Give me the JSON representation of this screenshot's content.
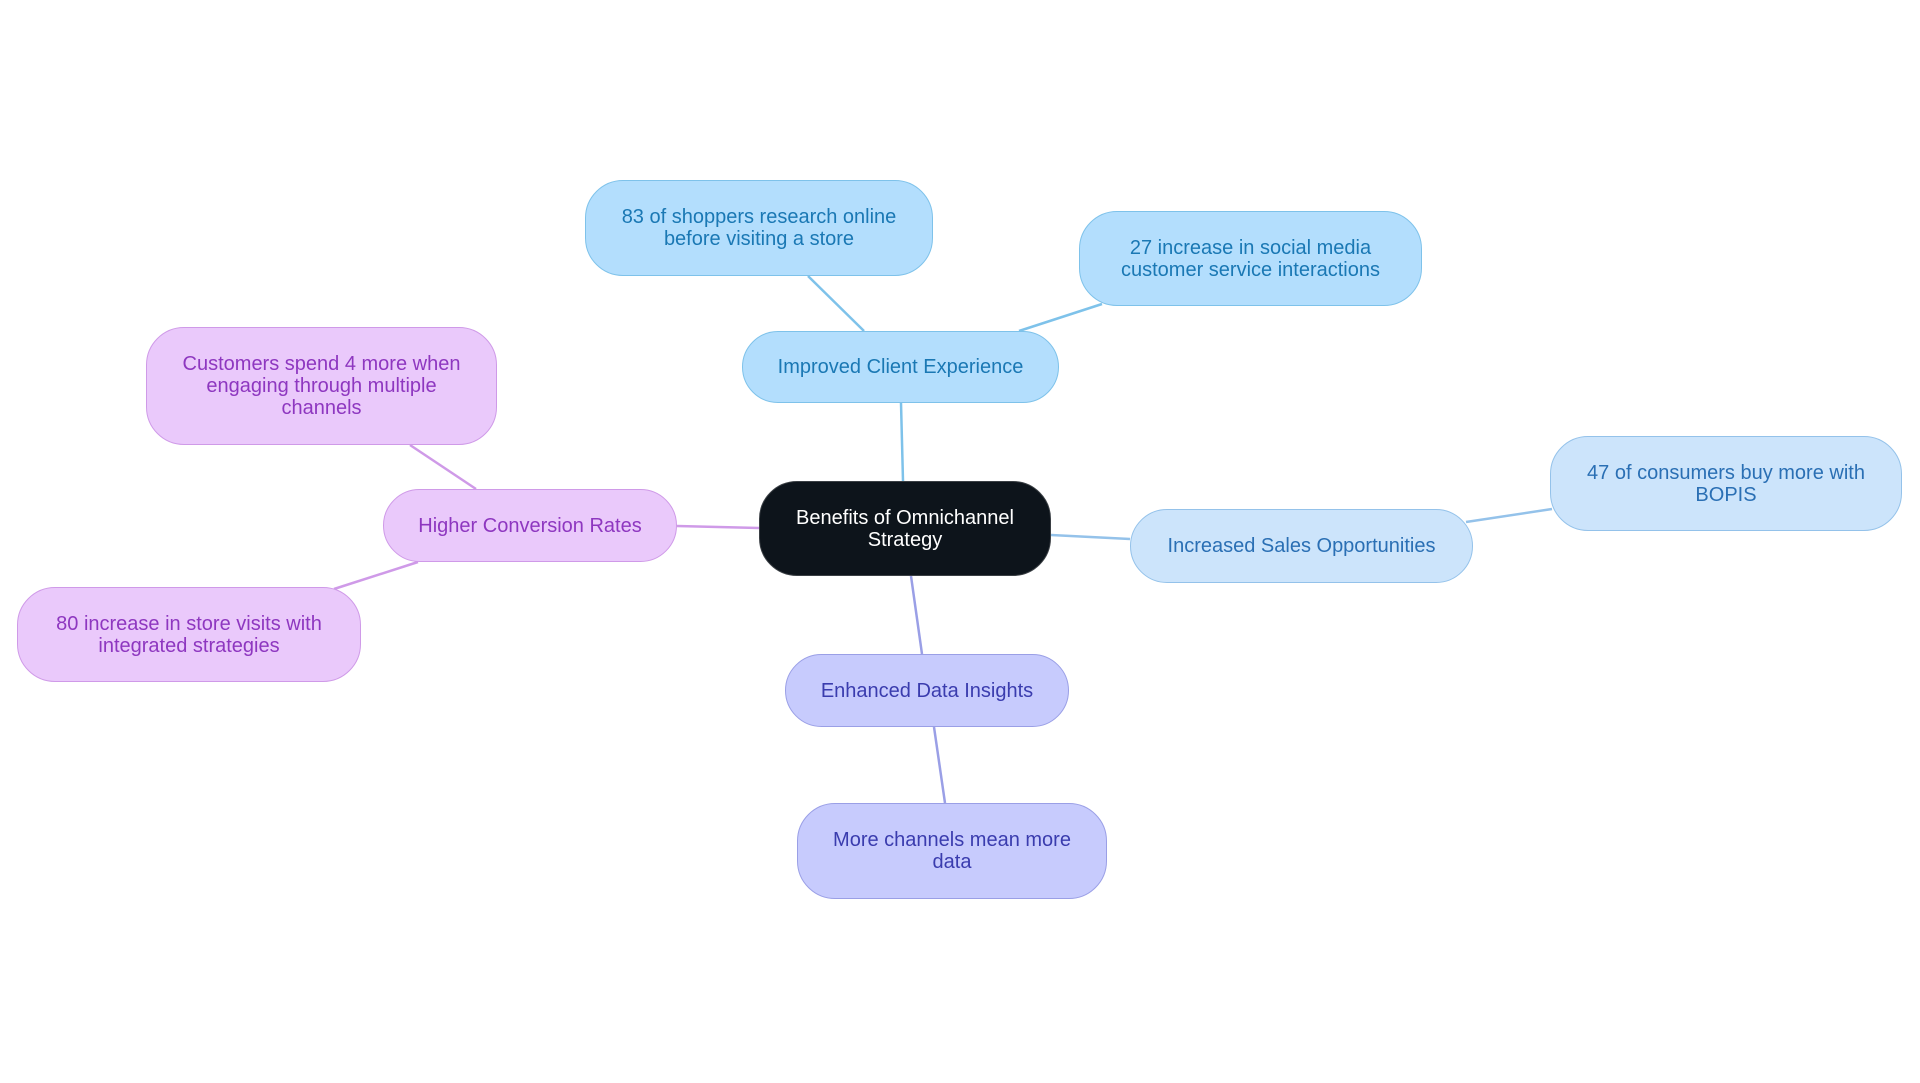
{
  "diagram": {
    "type": "mind-map",
    "root": {
      "label": "Benefits of Omnichannel Strategy"
    },
    "branches": [
      {
        "label": "Improved Client Experience",
        "color": "#b3defd",
        "children": [
          "83 of shoppers research online before visiting a store",
          "27 increase in social media customer service interactions"
        ]
      },
      {
        "label": "Higher Conversion Rates",
        "color": "#eac9fb",
        "children": [
          "Customers spend 4 more when engaging through multiple channels",
          "80 increase in store visits with integrated strategies"
        ]
      },
      {
        "label": "Increased Sales Opportunities",
        "color": "#cce4fb",
        "children": [
          "47 of consumers buy more with BOPIS"
        ]
      },
      {
        "label": "Enhanced Data Insights",
        "color": "#c7cbfd",
        "children": [
          "More channels mean more data"
        ]
      }
    ]
  },
  "colors": {
    "root_bg": "#0d141b",
    "blue_edge": "#7ec2ea",
    "purple_edge": "#cf9ae8",
    "lblue_edge": "#94c2ea",
    "indigo_edge": "#9a9fe6"
  }
}
